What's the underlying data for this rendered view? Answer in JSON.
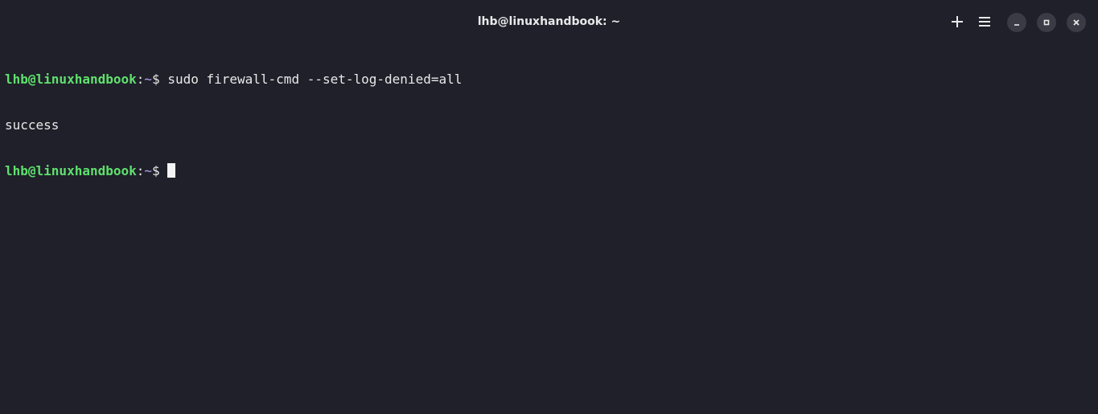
{
  "window": {
    "title": "lhb@linuxhandbook: ~"
  },
  "titlebar": {
    "icons": [
      "new-tab-icon",
      "menu-icon",
      "minimize-icon",
      "maximize-icon",
      "close-icon"
    ]
  },
  "terminal": {
    "prompt_user": "lhb@linuxhandbook",
    "prompt_sep": ":",
    "prompt_path": "~",
    "prompt_symbol": "$ ",
    "lines": [
      {
        "type": "prompt",
        "command": "sudo firewall-cmd --set-log-denied=all"
      },
      {
        "type": "output",
        "text": "success"
      },
      {
        "type": "prompt",
        "command": ""
      }
    ]
  },
  "colors": {
    "background": "#1f2029",
    "user": "#5fe06d",
    "path": "#b9a0f0",
    "text": "#e9e9ea"
  }
}
